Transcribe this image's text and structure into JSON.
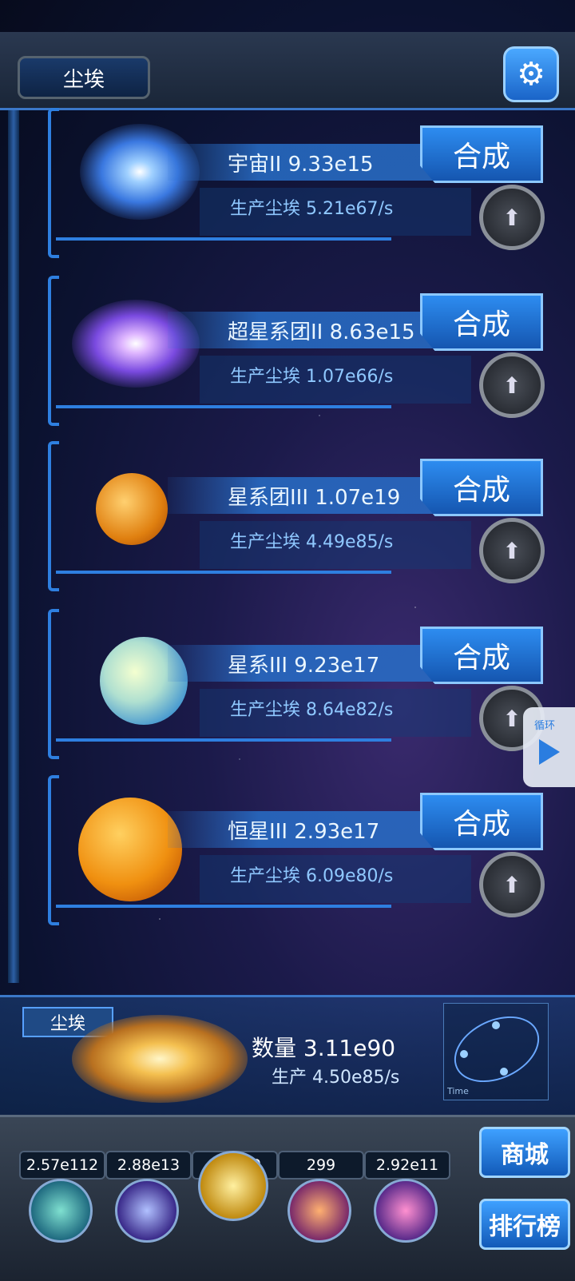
{
  "header": {
    "resource_tab": "尘埃",
    "settings_icon": "gear-icon"
  },
  "combine_label": "合成",
  "items": [
    {
      "title": "宇宙II 9.33e15",
      "production": "生产尘埃  5.21e67/s",
      "icon": "galaxy-icon"
    },
    {
      "title": "超星系团II 8.63e15",
      "production": "生产尘埃  1.07e66/s",
      "icon": "supercluster-icon"
    },
    {
      "title": "星系团III 1.07e19",
      "production": "生产尘埃  4.49e85/s",
      "icon": "galaxy-cluster-icon"
    },
    {
      "title": "星系III 9.23e17",
      "production": "生产尘埃  8.64e82/s",
      "icon": "galaxy3-icon"
    },
    {
      "title": "恒星III 2.93e17",
      "production": "生产尘埃  6.09e80/s",
      "icon": "star-icon"
    }
  ],
  "loop_widget": {
    "label": "循环"
  },
  "dust_panel": {
    "label": "尘埃",
    "amount": "数量 3.11e90",
    "rate": "生产 4.50e85/s",
    "diagram_axis": "Time"
  },
  "dock": {
    "counters": [
      "2.57e112",
      "2.88e13",
      "2.7e30",
      "299",
      "2.92e11"
    ],
    "shop_label": "商城",
    "rank_label": "排行榜"
  },
  "colors": {
    "accent": "#2e7fe0",
    "button": "#1556b0"
  }
}
